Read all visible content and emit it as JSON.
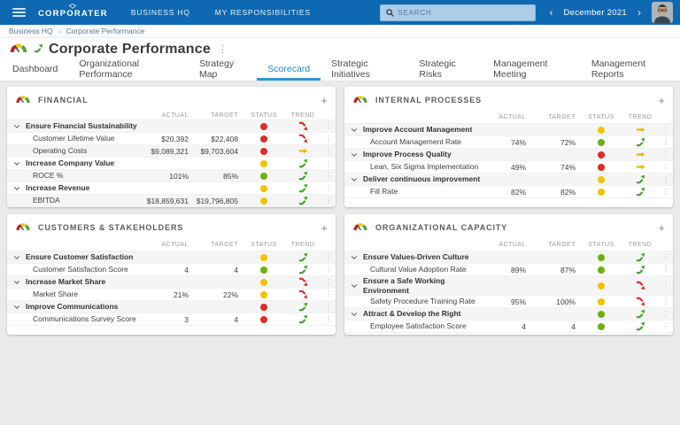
{
  "topbar": {
    "logo": "CORPORATER",
    "nav": [
      {
        "label": "BUSINESS HQ"
      },
      {
        "label": "MY RESPONSIBILITIES"
      }
    ],
    "search_placeholder": "SEARCH",
    "period": "December 2021",
    "prev_label": "‹",
    "next_label": "›"
  },
  "breadcrumb": {
    "items": [
      "Business HQ",
      "Corporate Performance"
    ],
    "separator": "›"
  },
  "page": {
    "title": "Corporate Performance",
    "menu_icon": "⋮"
  },
  "tabs": [
    "Dashboard",
    "Organizational Performance",
    "Strategy Map",
    "Scorecard",
    "Strategic Initiatives",
    "Strategic Risks",
    "Management Meeting",
    "Management Reports"
  ],
  "active_tab": "Scorecard",
  "columns": [
    "ACTUAL",
    "TARGET",
    "STATUS",
    "TREND"
  ],
  "panel_plus_label": "+",
  "row_kebab": "⋮",
  "colors": {
    "topbar_bg": "#0f68b2",
    "active_tab": "#1f87c5",
    "status_red": "#e02b27",
    "status_yellow": "#f2c204",
    "status_green": "#6db10e",
    "trend_up": "#45a32d",
    "trend_flat": "#f0b505",
    "trend_down": "#e02b27"
  },
  "panels": [
    {
      "title": "FINANCIAL",
      "rows": [
        {
          "label": "Ensure Financial Sustainability",
          "type": "parent",
          "actual": "",
          "target": "",
          "status": "red",
          "trend": "down"
        },
        {
          "label": "Customer Lifetime Value",
          "type": "child",
          "actual": "$20,392",
          "target": "$22,408",
          "status": "red",
          "trend": "down"
        },
        {
          "label": "Operating Costs",
          "type": "child",
          "actual": "$9,089,321",
          "target": "$9,703,604",
          "status": "red",
          "trend": "flat"
        },
        {
          "label": "Increase Company Value",
          "type": "parent",
          "actual": "",
          "target": "",
          "status": "yellow",
          "trend": "up"
        },
        {
          "label": "ROCE %",
          "type": "child",
          "actual": "101%",
          "target": "85%",
          "status": "green",
          "trend": "up"
        },
        {
          "label": "Increase Revenue",
          "type": "parent",
          "actual": "",
          "target": "",
          "status": "yellow",
          "trend": "up"
        },
        {
          "label": "EBITDA",
          "type": "child",
          "actual": "$18,859,631",
          "target": "$19,796,805",
          "status": "yellow",
          "trend": "up"
        }
      ]
    },
    {
      "title": "INTERNAL PROCESSES",
      "rows": [
        {
          "label": "Improve Account Management",
          "type": "parent",
          "actual": "",
          "target": "",
          "status": "yellow",
          "trend": "flat"
        },
        {
          "label": "Account Management Rate",
          "type": "child",
          "actual": "74%",
          "target": "72%",
          "status": "green",
          "trend": "up"
        },
        {
          "label": "Improve Process Quality",
          "type": "parent",
          "actual": "",
          "target": "",
          "status": "red",
          "trend": "flat"
        },
        {
          "label": "Lean, Six Sigma Implementation",
          "type": "child",
          "actual": "49%",
          "target": "74%",
          "status": "red",
          "trend": "flat"
        },
        {
          "label": "Deliver continuous improvement",
          "type": "parent",
          "actual": "",
          "target": "",
          "status": "yellow",
          "trend": "up"
        },
        {
          "label": "Fill Rate",
          "type": "child",
          "actual": "82%",
          "target": "82%",
          "status": "yellow",
          "trend": "up"
        }
      ]
    },
    {
      "title": "CUSTOMERS & STAKEHOLDERS",
      "rows": [
        {
          "label": "Ensure Customer Satisfaction",
          "type": "parent",
          "actual": "",
          "target": "",
          "status": "yellow",
          "trend": "up"
        },
        {
          "label": "Customer Satisfaction Score",
          "type": "child",
          "actual": "4",
          "target": "4",
          "status": "green",
          "trend": "up"
        },
        {
          "label": "Increase Market Share",
          "type": "parent",
          "actual": "",
          "target": "",
          "status": "yellow",
          "trend": "down"
        },
        {
          "label": "Market Share",
          "type": "child",
          "actual": "21%",
          "target": "22%",
          "status": "yellow",
          "trend": "down"
        },
        {
          "label": "Improve Communications",
          "type": "parent",
          "actual": "",
          "target": "",
          "status": "red",
          "trend": "up"
        },
        {
          "label": "Communications Survey Score",
          "type": "child",
          "actual": "3",
          "target": "4",
          "status": "red",
          "trend": "up"
        }
      ]
    },
    {
      "title": "ORGANIZATIONAL CAPACITY",
      "rows": [
        {
          "label": "Ensure Values-Driven Culture",
          "type": "parent",
          "actual": "",
          "target": "",
          "status": "green",
          "trend": "up"
        },
        {
          "label": "Cultural Value Adoption Rate",
          "type": "child",
          "actual": "89%",
          "target": "87%",
          "status": "green",
          "trend": "up"
        },
        {
          "label": "Ensure a Safe Working\nEnvironment",
          "type": "parent",
          "actual": "",
          "target": "",
          "status": "yellow",
          "trend": "down"
        },
        {
          "label": "Safety Procedure Training Rate",
          "type": "child",
          "actual": "95%",
          "target": "100%",
          "status": "yellow",
          "trend": "down"
        },
        {
          "label": "Attract & Develop the Right",
          "type": "parent",
          "actual": "",
          "target": "",
          "status": "green",
          "trend": "up"
        },
        {
          "label": "Employee Satisfaction Score",
          "type": "child",
          "actual": "4",
          "target": "4",
          "status": "green",
          "trend": "up"
        }
      ]
    }
  ]
}
